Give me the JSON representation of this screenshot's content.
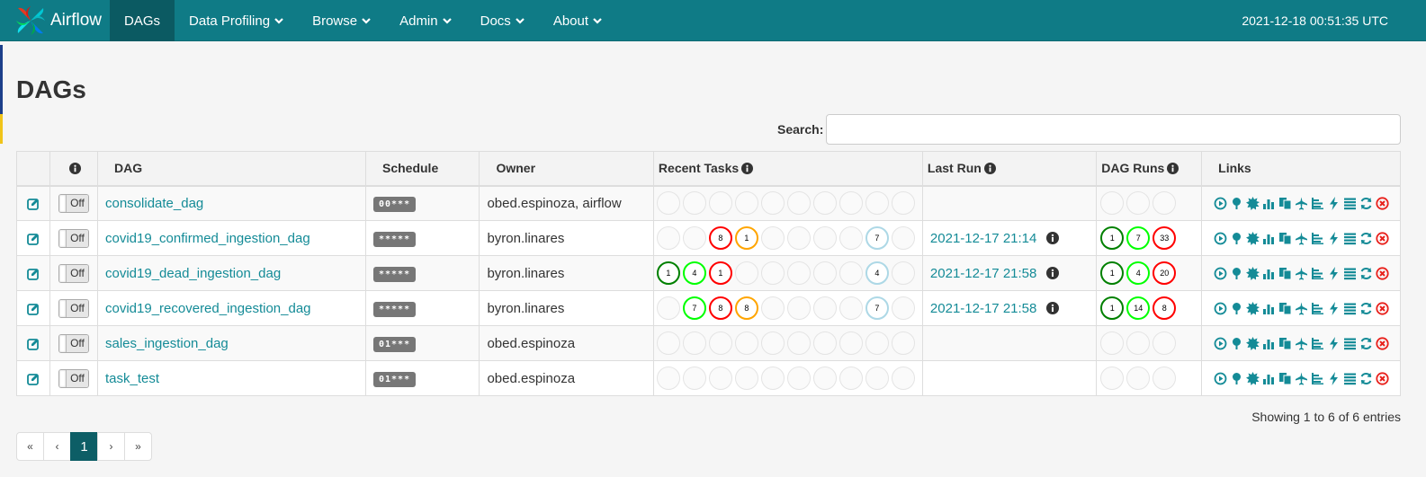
{
  "nav": {
    "brand": "Airflow",
    "items": [
      {
        "label": "DAGs",
        "active": true,
        "dropdown": false
      },
      {
        "label": "Data Profiling",
        "dropdown": true
      },
      {
        "label": "Browse",
        "dropdown": true
      },
      {
        "label": "Admin",
        "dropdown": true
      },
      {
        "label": "Docs",
        "dropdown": true
      },
      {
        "label": "About",
        "dropdown": true
      }
    ],
    "time": "2021-12-18 00:51:35 UTC"
  },
  "page": {
    "title": "DAGs"
  },
  "search": {
    "label": "Search:",
    "value": ""
  },
  "table": {
    "headers": {
      "dag": "DAG",
      "schedule": "Schedule",
      "owner": "Owner",
      "recent_tasks": "Recent Tasks",
      "last_run": "Last Run",
      "dag_runs": "DAG Runs",
      "links": "Links"
    },
    "rows": [
      {
        "toggle": "Off",
        "dag": "consolidate_dag",
        "schedule": "0 0 * * *",
        "owner": "obed.espinoza, airflow",
        "tasks": [
          "",
          "",
          "",
          "",
          "",
          "",
          "",
          "",
          "",
          ""
        ],
        "last_run": "",
        "runs": [
          "",
          "",
          ""
        ]
      },
      {
        "toggle": "Off",
        "dag": "covid19_confirmed_ingestion_dag",
        "schedule": "* * * * *",
        "owner": "byron.linares",
        "tasks": [
          "",
          "",
          "8",
          "1",
          "",
          "",
          "",
          "",
          "7",
          ""
        ],
        "last_run": "2021-12-17 21:14",
        "runs": [
          "1",
          "7",
          "33"
        ]
      },
      {
        "toggle": "Off",
        "dag": "covid19_dead_ingestion_dag",
        "schedule": "* * * * *",
        "owner": "byron.linares",
        "tasks": [
          "1",
          "4",
          "1",
          "",
          "",
          "",
          "",
          "",
          "4",
          ""
        ],
        "last_run": "2021-12-17 21:58",
        "runs": [
          "1",
          "4",
          "20"
        ]
      },
      {
        "toggle": "Off",
        "dag": "covid19_recovered_ingestion_dag",
        "schedule": "* * * * *",
        "owner": "byron.linares",
        "tasks": [
          "",
          "7",
          "8",
          "8",
          "",
          "",
          "",
          "",
          "7",
          ""
        ],
        "last_run": "2021-12-17 21:58",
        "runs": [
          "1",
          "14",
          "8"
        ]
      },
      {
        "toggle": "Off",
        "dag": "sales_ingestion_dag",
        "schedule": "0 1 * * *",
        "owner": "obed.espinoza",
        "tasks": [
          "",
          "",
          "",
          "",
          "",
          "",
          "",
          "",
          "",
          ""
        ],
        "last_run": "",
        "runs": [
          "",
          "",
          ""
        ]
      },
      {
        "toggle": "Off",
        "dag": "task_test",
        "schedule": "0 1 * * *",
        "owner": "obed.espinoza",
        "tasks": [
          "",
          "",
          "",
          "",
          "",
          "",
          "",
          "",
          "",
          ""
        ],
        "last_run": "",
        "runs": [
          "",
          "",
          ""
        ]
      }
    ]
  },
  "footer": {
    "entries_info": "Showing 1 to 6 of 6 entries",
    "pager": [
      "«",
      "‹",
      "1",
      "›",
      "»"
    ]
  },
  "colors": {
    "navbar": "#0f7b86",
    "link": "#148b97",
    "success": "#008000",
    "running": "#00ff00",
    "failed": "#ff0000",
    "upstream_failed": "#ffa500",
    "skipped": "#add8e6"
  }
}
